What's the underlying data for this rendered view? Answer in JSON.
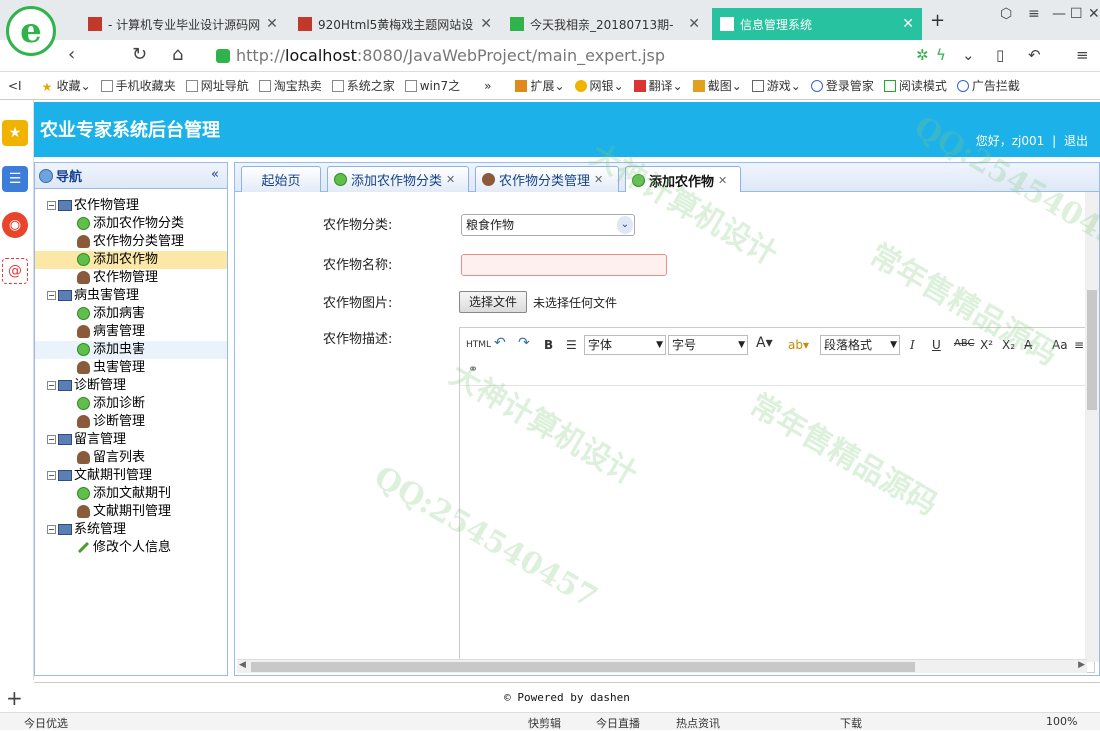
{
  "browser": {
    "tabs": [
      {
        "title": "- 计算机专业毕业设计源码网"
      },
      {
        "title": "920Html5黄梅戏主题网站设"
      },
      {
        "title": "今天我相亲_20180713期- "
      },
      {
        "title": "信息管理系统"
      }
    ],
    "new_tab": "+",
    "url": {
      "scheme": "http://",
      "host": "localhost",
      "rest": ":8080/JavaWebProject/main_expert.jsp"
    },
    "bookmarks": [
      "收藏",
      "手机收藏夹",
      "网址导航",
      "淘宝热卖",
      "系统之家",
      "win7之",
      "扩展",
      "网银",
      "翻译",
      "截图",
      "游戏",
      "登录管家",
      "阅读模式",
      "广告拦截"
    ],
    "status": {
      "left": "今日优选",
      "items": [
        "快剪辑",
        "今日直播",
        "热点资讯",
        "下载",
        "100%"
      ]
    }
  },
  "app": {
    "title": "农业专家系统后台管理",
    "greeting": "您好，zj001",
    "separator": "|",
    "logout": "退出"
  },
  "nav": {
    "title": "导航",
    "collapse": "«",
    "groups": [
      {
        "label": "农作物管理",
        "items": [
          {
            "label": "添加农作物分类",
            "icon": "add-icon"
          },
          {
            "label": "农作物分类管理",
            "icon": "person-icon"
          },
          {
            "label": "添加农作物",
            "icon": "add-icon"
          },
          {
            "label": "农作物管理",
            "icon": "person-icon"
          }
        ]
      },
      {
        "label": "病虫害管理",
        "items": [
          {
            "label": "添加病害",
            "icon": "add-icon"
          },
          {
            "label": "病害管理",
            "icon": "person-icon"
          },
          {
            "label": "添加虫害",
            "icon": "add-icon"
          },
          {
            "label": "虫害管理",
            "icon": "person-icon"
          }
        ]
      },
      {
        "label": "诊断管理",
        "items": [
          {
            "label": "添加诊断",
            "icon": "add-icon"
          },
          {
            "label": "诊断管理",
            "icon": "person-icon"
          }
        ]
      },
      {
        "label": "留言管理",
        "items": [
          {
            "label": "留言列表",
            "icon": "person-icon"
          }
        ]
      },
      {
        "label": "文献期刊管理",
        "items": [
          {
            "label": "添加文献期刊",
            "icon": "add-icon"
          },
          {
            "label": "文献期刊管理",
            "icon": "person-icon"
          }
        ]
      },
      {
        "label": "系统管理",
        "items": [
          {
            "label": "修改个人信息",
            "icon": "pencil-icon"
          }
        ]
      }
    ]
  },
  "tabs": [
    {
      "label": "起始页"
    },
    {
      "label": "添加农作物分类"
    },
    {
      "label": "农作物分类管理"
    },
    {
      "label": "添加农作物"
    }
  ],
  "form": {
    "category_label": "农作物分类:",
    "category_value": "粮食作物",
    "name_label": "农作物名称:",
    "name_value": "",
    "image_label": "农作物图片:",
    "file_button": "选择文件",
    "file_status": "未选择任何文件",
    "desc_label": "农作物描述:"
  },
  "editor": {
    "html": "HTML",
    "font": "字体",
    "size": "字号",
    "paragraph": "段落格式"
  },
  "footer": {
    "text": "© Powered by dashen"
  },
  "watermark": {
    "texts": [
      "常年售精品源码",
      "QQ:254540457",
      "大神计算机设计"
    ]
  }
}
